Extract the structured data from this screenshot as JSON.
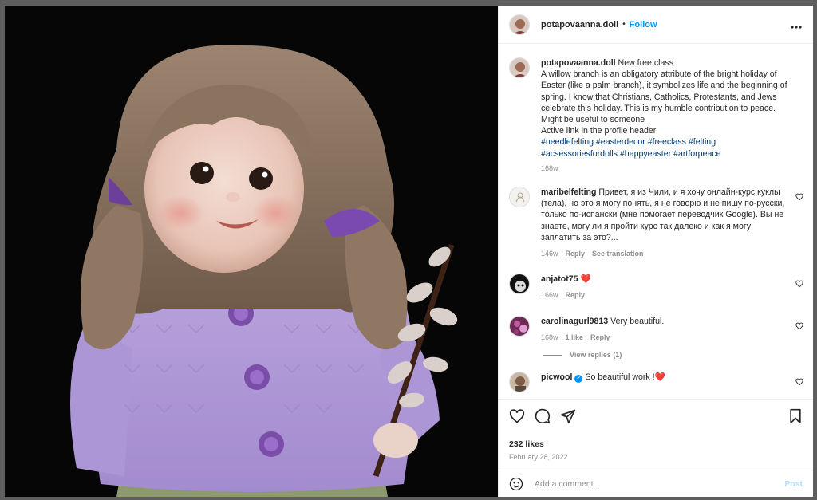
{
  "post": {
    "username": "potapovaanna.doll",
    "dot": "•",
    "follow_label": "Follow",
    "more_label": "•••"
  },
  "caption": {
    "username": "potapovaanna.doll",
    "text_lines": [
      "New free class",
      "A willow branch is an obligatory attribute of the bright holiday of Easter (like a palm branch), it symbolizes life and the beginning of spring. I know that Christians, Catholics, Protestants, and Jews celebrate this holiday. This is my humble contribution to peace.",
      "Might be useful to someone",
      "Active link in the profile header"
    ],
    "hashtags": "#needlefelting #easterdecor #freeclass #felting #acsessoriesfordolls #happyeaster #artforpeace",
    "age": "168w"
  },
  "comments": [
    {
      "username": "maribelfelting",
      "text": "Привет, я из Чили, и я хочу онлайн-курс куклы (тела), но это я могу понять, я не говорю и не пишу по-русски, только по-испански (мне помогает переводчик Google). Вы не знаете, могу ли я пройти курс так далеко и как я могу заплатить за это?...",
      "age": "146w",
      "reply": "Reply",
      "translate": "See translation"
    },
    {
      "username": "anjatot75",
      "text": "❤️",
      "age": "166w",
      "reply": "Reply"
    },
    {
      "username": "carolinagurl9813",
      "text": "Very beautiful.",
      "age": "168w",
      "likes": "1 like",
      "reply": "Reply",
      "view_replies": "View replies (1)"
    },
    {
      "username": "picwool",
      "text": "So beautiful work !❤️",
      "verified_mark": "✓"
    }
  ],
  "footer": {
    "likes": "232 likes",
    "date": "February 28, 2022",
    "comment_placeholder": "Add a comment...",
    "post_label": "Post"
  },
  "colors": {
    "link": "#00376b",
    "accent": "#0095f6",
    "muted": "#8e8e8e",
    "post_disabled": "#b2dffc"
  },
  "icons": [
    "heart-icon",
    "comment-icon",
    "share-icon",
    "bookmark-icon",
    "emoji-icon",
    "more-icon",
    "verified-icon"
  ]
}
